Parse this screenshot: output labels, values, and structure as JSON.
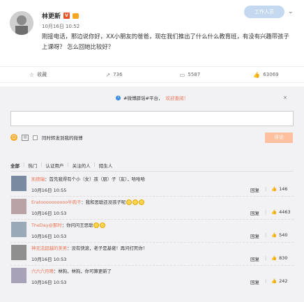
{
  "post": {
    "author": "林更新",
    "v_badge": "V",
    "time": "10月16日 10:52",
    "body": "刚接电话，那边说你好，XX小朋友的爸爸，现在我们推出了什么什么教育班，有没有兴趣带孩子上课呀？ 怎么回她比较好？",
    "top_badge": "工作人员"
  },
  "actions": [
    {
      "icon": "star-icon",
      "glyph": "☆",
      "label": "收藏"
    },
    {
      "icon": "share-icon",
      "glyph": "↗",
      "label": "736"
    },
    {
      "icon": "comment-icon",
      "glyph": "▭",
      "label": "5587"
    },
    {
      "icon": "like-icon",
      "glyph": "👍",
      "label": "63069"
    }
  ],
  "panel": {
    "notice_text": "#微博辟谣#平台，",
    "notice_link": "欢迎查阅！",
    "close": "×",
    "also_forward": "同时转发到我的微博",
    "submit": "评论"
  },
  "filters": [
    {
      "label": "全部",
      "active": true
    },
    {
      "label": "热门",
      "active": false
    },
    {
      "label": "认证用户",
      "active": false
    },
    {
      "label": "关注的人",
      "active": false
    },
    {
      "label": "陌生人",
      "active": false
    }
  ],
  "comments": [
    {
      "user": "凯德瑞",
      "text": "：首先我得有个小（女）孩（朋）子（友），哈哈哈",
      "faces": 0,
      "time": "10月16日 10:55",
      "reply": "回复",
      "likes": "146"
    },
    {
      "user": "Eratoooooooooo牛肉干",
      "text": "：我和思聪还没孩子呢",
      "faces": 3,
      "time": "10月16日 10:53",
      "reply": "回复",
      "likes": "4463"
    },
    {
      "user": "TheDay@那时",
      "text": "：你问问王思聪",
      "faces": 2,
      "time": "10月16日 10:53",
      "reply": "回复",
      "likes": "540"
    },
    {
      "user": "神无法超越的美男",
      "text": "：没有快滚，老子是基佬！再问打死你！",
      "faces": 0,
      "time": "10月16日 10:53",
      "reply": "回复",
      "likes": "830"
    },
    {
      "user": "六六六月晴",
      "text": "：林狗，林狗，你可算更新了",
      "faces": 0,
      "time": "10月16日 10:53",
      "reply": "回复",
      "likes": "242"
    }
  ]
}
